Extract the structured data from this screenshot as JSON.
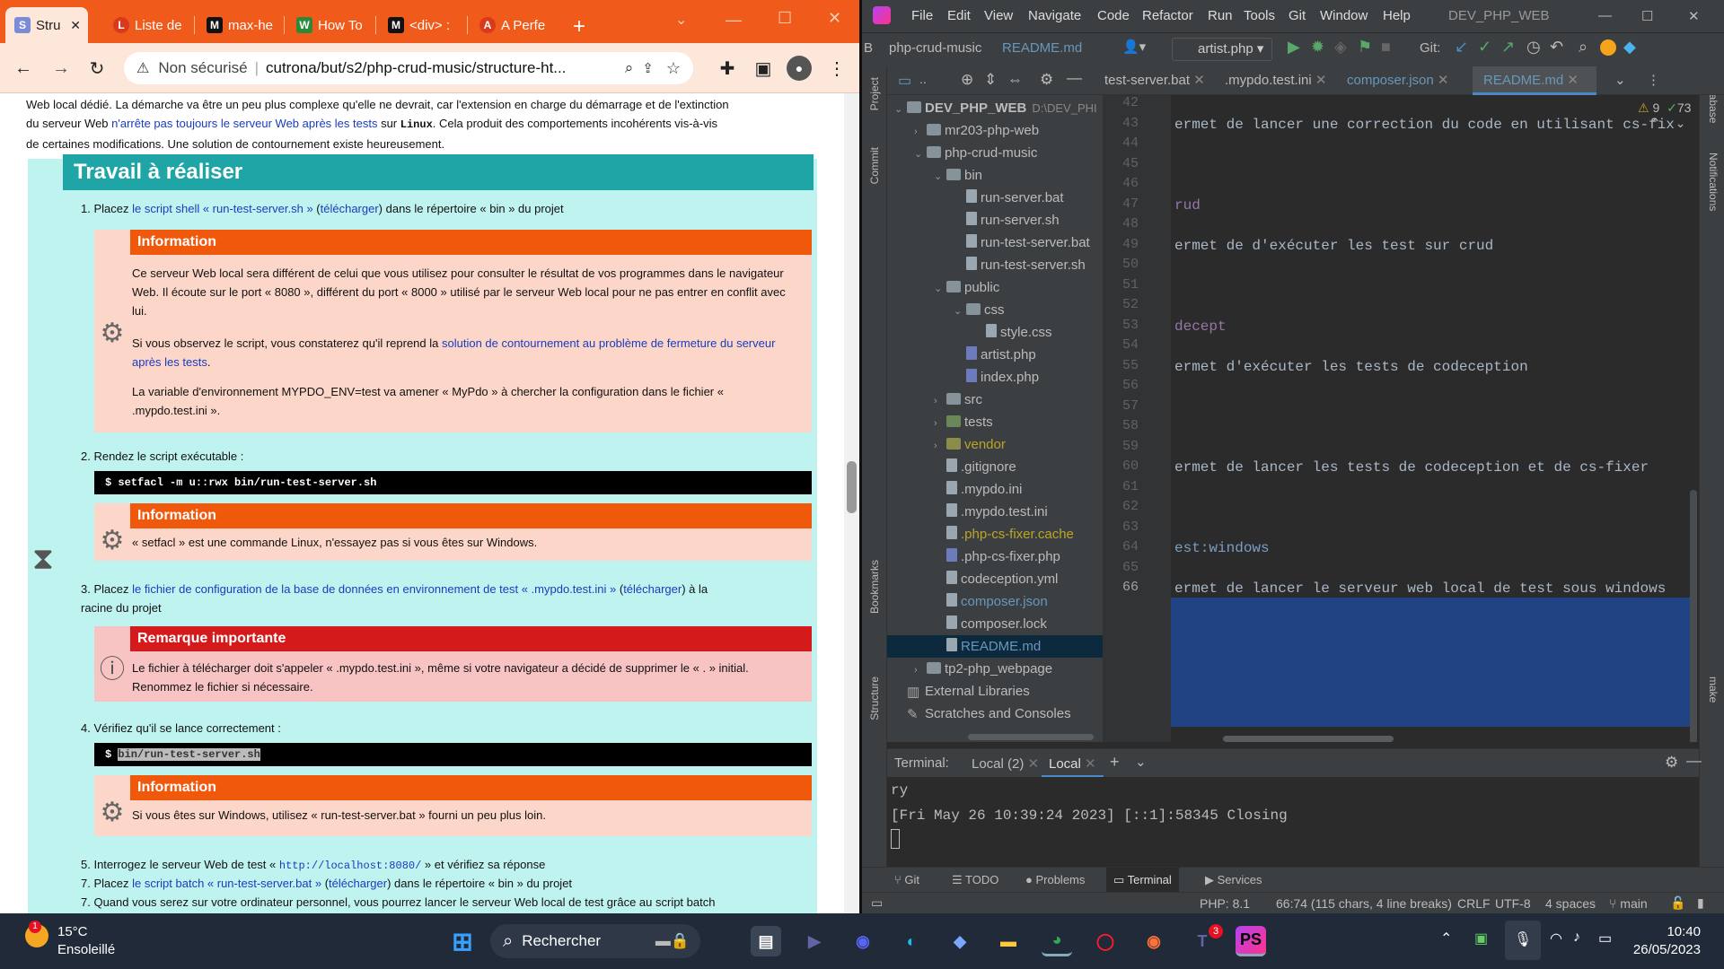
{
  "browser": {
    "tabs": [
      {
        "label": "Stru",
        "active": true,
        "fav": "S"
      },
      {
        "label": "Liste de",
        "fav": "L"
      },
      {
        "label": "max-he",
        "fav": "M"
      },
      {
        "label": "How To",
        "fav": "W"
      },
      {
        "label": "<div> :",
        "fav": "M"
      },
      {
        "label": "A Perfe",
        "fav": "A"
      }
    ],
    "address": {
      "security": "Non sécurisé",
      "url": "cutrona/but/s2/php-crud-music/structure-ht..."
    },
    "intro": {
      "line1": "Web local dédié. La démarche va être un peu plus complexe qu'elle ne devrait, car l'extension en charge du démarrage et de l'extinction",
      "line2a": "du serveur Web ",
      "line2link": "n'arrête pas toujours le serveur Web après les tests",
      "line2b": " sur ",
      "line2mono": "Linux",
      "line2c": ". Cela produit des comportements incohérents vis-à-vis",
      "line3": "de certaines modifications. Une solution de contournement existe heureusement."
    },
    "section_title": "Travail à réaliser",
    "steps": {
      "s1": {
        "a": "1. Placez ",
        "link": "le script shell « run-test-server.sh »",
        "b": " (",
        "dl": "télécharger",
        "c": ") dans le répertoire « bin » du projet"
      },
      "info1": {
        "title": "Information",
        "p1": "Ce serveur Web local sera différent de celui que vous utilisez pour consulter le résultat de vos programmes dans le navigateur Web. Il écoute sur le port « 8080 », différent du port « 8000 » utilisé par le serveur Web local pour ne pas entrer en conflit avec lui.",
        "p2a": "Si vous observez le script, vous constaterez qu'il reprend la ",
        "p2link": "solution de contournement au problème de fermeture du serveur après les tests",
        "p2b": ".",
        "p3": "La variable d'environnement MYPDO_ENV=test va amener « MyPdo » à chercher la configuration dans le fichier « .mypdo.test.ini »."
      },
      "s2": "2. Rendez le script exécutable :",
      "code1": "$ setfacl -m u::rwx bin/run-test-server.sh",
      "info2": {
        "title": "Information",
        "text": "« setfacl » est une commande Linux, n'essayez pas si vous êtes sur Windows."
      },
      "s3": {
        "a": "3. Placez ",
        "link": "le fichier de configuration de la base de données en environnement de test « .mypdo.test.ini »",
        "b": " (",
        "dl": "télécharger",
        "c": ") à la",
        "d": "racine du projet"
      },
      "warn": {
        "title": "Remarque importante",
        "text": "Le fichier à télécharger doit s'appeler « .mypdo.test.ini », même si votre navigateur a décidé de supprimer le « . » initial. Renommez le fichier si nécessaire."
      },
      "s4": "4. Vérifiez qu'il se lance correctement :",
      "code2_prompt": "$",
      "code2_cmd": "bin/run-test-server.sh",
      "info3": {
        "title": "Information",
        "text": "Si vous êtes sur Windows, utilisez « run-test-server.bat » fourni un peu plus loin."
      },
      "s5": {
        "a": "5. Interrogez le serveur Web de test « ",
        "link": "http://localhost:8080/",
        "b": " » et vérifiez sa réponse"
      },
      "s7": {
        "a": "7. Placez ",
        "link": "le script batch « run-test-server.bat »",
        "b": " (",
        "dl": "télécharger",
        "c": ") dans le répertoire « bin » du projet"
      },
      "s8": "7. Quand vous serez sur votre ordinateur personnel, vous pourrez lancer le serveur Web local de test grâce au script batch"
    }
  },
  "ide": {
    "menu": [
      "File",
      "Edit",
      "View",
      "Navigate",
      "Code",
      "Refactor",
      "Run",
      "Tools",
      "Git",
      "Window",
      "Help"
    ],
    "project_name": "DEV_PHP_WEB",
    "breadcrumb": [
      "php-crud-music",
      "README.md"
    ],
    "run_config": "artist.php",
    "git_label": "Git:",
    "editor_tabs": [
      "test-server.bat",
      ".mypdo.test.ini",
      "composer.json",
      "README.md"
    ],
    "tree": [
      {
        "label": "DEV_PHP_WEB",
        "extra": "D:\\DEV_PHI",
        "level": 0,
        "type": "folder",
        "open": true
      },
      {
        "label": "mr203-php-web",
        "level": 1,
        "type": "folder"
      },
      {
        "label": "php-crud-music",
        "level": 1,
        "type": "folder",
        "open": true
      },
      {
        "label": "bin",
        "level": 2,
        "type": "folder",
        "open": true
      },
      {
        "label": "run-server.bat",
        "level": 3,
        "type": "file"
      },
      {
        "label": "run-server.sh",
        "level": 3,
        "type": "file"
      },
      {
        "label": "run-test-server.bat",
        "level": 3,
        "type": "file"
      },
      {
        "label": "run-test-server.sh",
        "level": 3,
        "type": "file"
      },
      {
        "label": "public",
        "level": 2,
        "type": "folder",
        "open": true
      },
      {
        "label": "css",
        "level": 3,
        "type": "folder",
        "open": true
      },
      {
        "label": "style.css",
        "level": 4,
        "type": "file"
      },
      {
        "label": "artist.php",
        "level": 3,
        "type": "php"
      },
      {
        "label": "index.php",
        "level": 3,
        "type": "php"
      },
      {
        "label": "src",
        "level": 2,
        "type": "folder"
      },
      {
        "label": "tests",
        "level": 2,
        "type": "folder-green"
      },
      {
        "label": "vendor",
        "level": 2,
        "type": "folder-yellow"
      },
      {
        "label": ".gitignore",
        "level": 2,
        "type": "file"
      },
      {
        "label": ".mypdo.ini",
        "level": 2,
        "type": "file"
      },
      {
        "label": ".mypdo.test.ini",
        "level": 2,
        "type": "file"
      },
      {
        "label": ".php-cs-fixer.cache",
        "level": 2,
        "type": "file"
      },
      {
        "label": ".php-cs-fixer.php",
        "level": 2,
        "type": "php"
      },
      {
        "label": "codeception.yml",
        "level": 2,
        "type": "file"
      },
      {
        "label": "composer.json",
        "level": 2,
        "type": "file"
      },
      {
        "label": "composer.lock",
        "level": 2,
        "type": "file"
      },
      {
        "label": "README.md",
        "level": 2,
        "type": "file"
      },
      {
        "label": "tp2-php_webpage",
        "level": 1,
        "type": "folder"
      },
      {
        "label": "External Libraries",
        "level": 0,
        "type": "lib"
      },
      {
        "label": "Scratches and Consoles",
        "level": 0,
        "type": "scratch"
      }
    ],
    "line_numbers": [
      "42",
      "43",
      "44",
      "45",
      "46",
      "47",
      "48",
      "49",
      "50",
      "51",
      "52",
      "53",
      "54",
      "55",
      "56",
      "57",
      "58",
      "59",
      "60",
      "61",
      "62",
      "63",
      "64",
      "65",
      "66"
    ],
    "code_lines": {
      "43": "ermet de lancer une correction du code en utilisant cs-fix",
      "47": "rud",
      "49": "ermet de d'exécuter les test sur crud",
      "53": "decept",
      "55": "ermet d'exécuter les tests de codeception",
      "60": "ermet de lancer les tests de codeception et de cs-fixer",
      "64": "est:windows",
      "66": "ermet de lancer le serveur web local de test sous windows"
    },
    "inspections": {
      "warnings": "9",
      "checks": "73"
    },
    "terminal": {
      "label": "Terminal:",
      "tabs": [
        "Local (2)",
        "Local"
      ],
      "line1": "ry",
      "line2": "[Fri May 26 10:39:24 2023] [::1]:58345 Closing"
    },
    "bottom_tabs": [
      "Git",
      "TODO",
      "Problems",
      "Terminal",
      "Services"
    ],
    "status": {
      "php": "PHP: 8.1",
      "pos": "66:74 (115 chars, 4 line breaks)",
      "eol": "CRLF",
      "enc": "UTF-8",
      "indent": "4 spaces",
      "branch": "main"
    },
    "side_labels": {
      "project": "Project",
      "commit": "Commit",
      "bookmarks": "Bookmarks",
      "structure": "Structure",
      "database": "Database",
      "notifications": "Notifications",
      "make": "make"
    }
  },
  "taskbar": {
    "weather_temp": "15°C",
    "weather_desc": "Ensoleillé",
    "weather_badge": "1",
    "search": "Rechercher",
    "teams_badge": "3",
    "time": "10:40",
    "date": "26/05/2023"
  }
}
